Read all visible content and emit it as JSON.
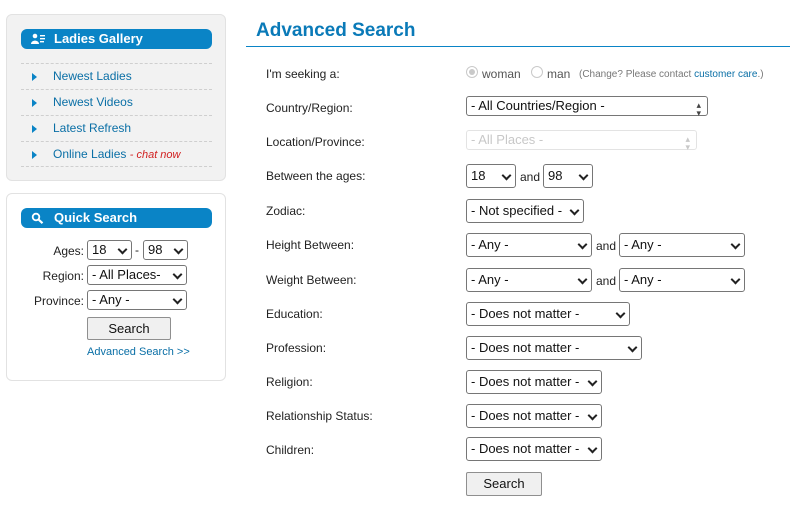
{
  "sidebar": {
    "gallery": {
      "title": "Ladies Gallery",
      "items": [
        {
          "label": "Newest Ladies"
        },
        {
          "label": "Newest Videos"
        },
        {
          "label": "Latest Refresh"
        },
        {
          "label": "Online Ladies",
          "suffix": "- chat now"
        }
      ]
    },
    "quick_search": {
      "title": "Quick Search",
      "ages_label": "Ages:",
      "age_min": "18",
      "age_sep": "-",
      "age_max": "98",
      "region_label": "Region:",
      "region_value": "- All Places-",
      "province_label": "Province:",
      "province_value": "- Any -",
      "search_button": "Search",
      "advanced_link": "Advanced Search >>"
    }
  },
  "main": {
    "title": "Advanced Search",
    "seeking": {
      "label": "I'm seeking a:",
      "option_woman": "woman",
      "option_man": "man",
      "selected": "woman",
      "note_prefix": "(Change? Please contact ",
      "note_link": "customer care",
      "note_suffix": ".)"
    },
    "country": {
      "label": "Country/Region:",
      "value": "- All Countries/Region -"
    },
    "location": {
      "label": "Location/Province:",
      "value": "- All Places -"
    },
    "ages": {
      "label": "Between the ages:",
      "min": "18",
      "and": "and",
      "max": "98"
    },
    "zodiac": {
      "label": "Zodiac:",
      "value": "- Not specified -"
    },
    "height": {
      "label": "Height Between:",
      "min": "- Any -",
      "and": "and",
      "max": "- Any -"
    },
    "weight": {
      "label": "Weight Between:",
      "min": "- Any -",
      "and": "and",
      "max": "- Any -"
    },
    "education": {
      "label": "Education:",
      "value": "- Does not matter -"
    },
    "profession": {
      "label": "Profession:",
      "value": "- Does not matter -"
    },
    "religion": {
      "label": "Religion:",
      "value": "- Does not matter -"
    },
    "relationship": {
      "label": "Relationship Status:",
      "value": "- Does not matter -"
    },
    "children": {
      "label": "Children:",
      "value": "- Does not matter -"
    },
    "search_button": "Search"
  },
  "colors": {
    "accent": "#0a84c6",
    "title": "#0a7ab8",
    "link": "#0a6fa6",
    "chat": "#d12020"
  },
  "icons": {
    "gallery": "user-list-icon",
    "quick_search": "search-icon",
    "nav_bullet": "triangle-right-icon"
  }
}
